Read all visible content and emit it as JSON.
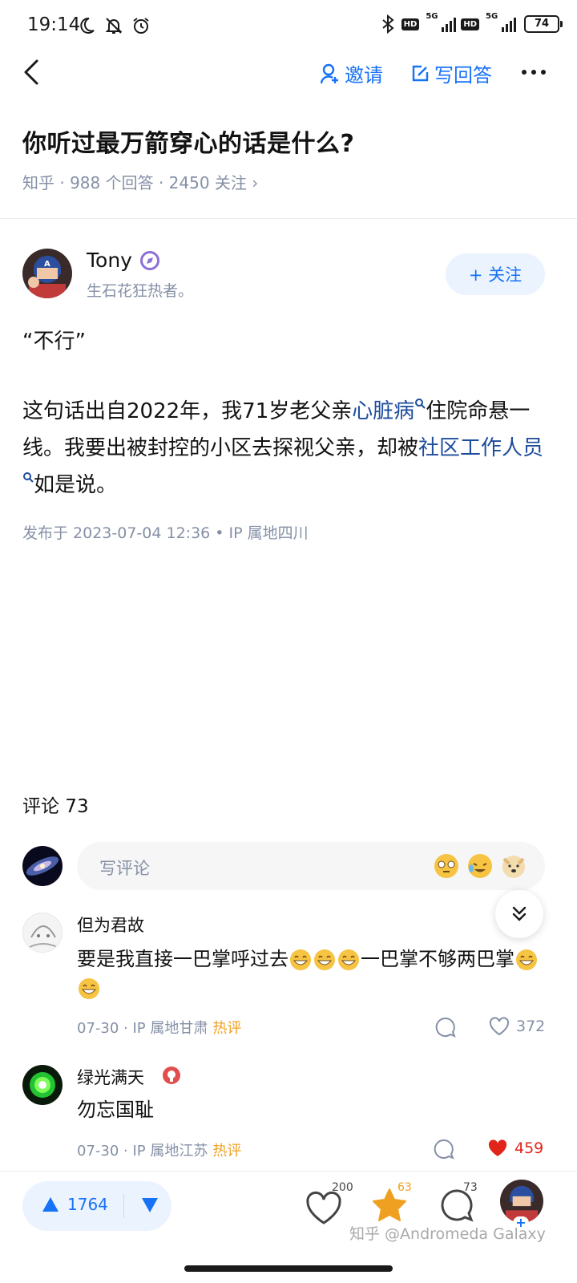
{
  "status_bar": {
    "time": "19:14",
    "left_icons": [
      "moon-icon",
      "muted-bell-icon",
      "alarm-icon"
    ],
    "network_label_1": "5G",
    "network_label_2": "5G",
    "hd_label": "HD",
    "battery": "74"
  },
  "nav": {
    "invite_label": "邀请",
    "answer_label": "写回答"
  },
  "question": {
    "title": "你听过最万箭穿心的话是什么?",
    "meta": "知乎 · 988 个回答 · 2450 关注 ›"
  },
  "author": {
    "name": "Tony",
    "bio": "生石花狂热者。",
    "follow_label": "+ 关注"
  },
  "answer": {
    "quote": "“不行”",
    "p_part1": "这句话出自2022年，我71岁老父亲",
    "link1": "心脏病",
    "p_part2": "住院命悬一线。我要出被封控的小区去探视父亲，却被",
    "link2": "社区工作人员",
    "p_part3": "如是说。",
    "published": "发布于 2023-07-04 12:36 • IP 属地四川"
  },
  "comments": {
    "title": "评论 73",
    "input_placeholder": "写评论",
    "items": [
      {
        "name": "但为君故",
        "text_a": "要是我直接一巴掌呼过去",
        "text_b": "一巴掌不够两巴掌",
        "date_ip": "07-30 · IP 属地甘肃",
        "tag": "热评",
        "likes": "372"
      },
      {
        "name": "绿光满天",
        "text": "勿忘国耻",
        "date_ip": "07-30 · IP 属地江苏",
        "tag": "热评",
        "likes": "459"
      }
    ]
  },
  "bottom_bar": {
    "upvotes": "1764",
    "likes": "200",
    "stars": "63",
    "comments": "73",
    "watermark": "知乎 @Andromeda Galaxy"
  },
  "colors": {
    "accent": "#1772f6",
    "link": "#1c4c9c",
    "meta": "#8590a6",
    "hot": "#f0a020",
    "liked": "#e1251b"
  }
}
